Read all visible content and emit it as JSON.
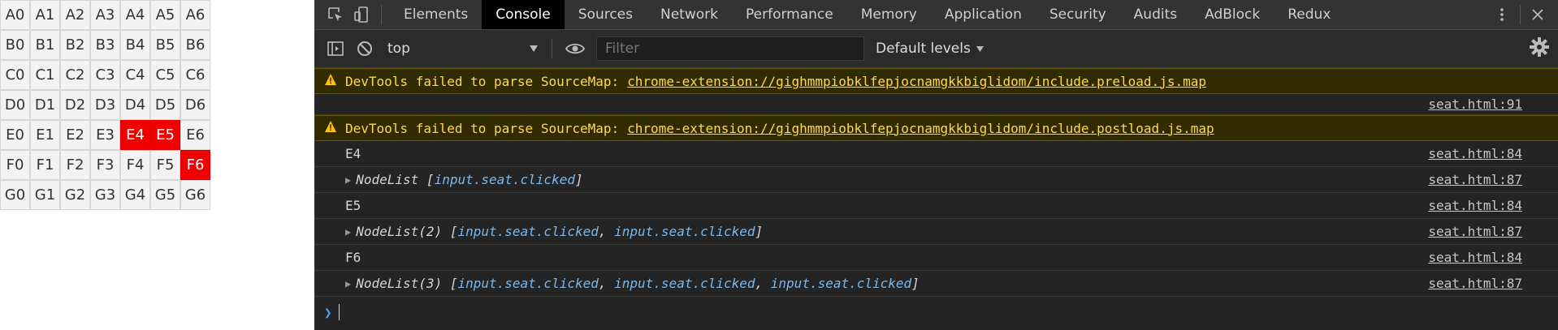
{
  "seats": [
    [
      {
        "label": "A0",
        "clicked": false
      },
      {
        "label": "A1",
        "clicked": false
      },
      {
        "label": "A2",
        "clicked": false
      },
      {
        "label": "A3",
        "clicked": false
      },
      {
        "label": "A4",
        "clicked": false
      },
      {
        "label": "A5",
        "clicked": false
      },
      {
        "label": "A6",
        "clicked": false
      }
    ],
    [
      {
        "label": "B0",
        "clicked": false
      },
      {
        "label": "B1",
        "clicked": false
      },
      {
        "label": "B2",
        "clicked": false
      },
      {
        "label": "B3",
        "clicked": false
      },
      {
        "label": "B4",
        "clicked": false
      },
      {
        "label": "B5",
        "clicked": false
      },
      {
        "label": "B6",
        "clicked": false
      }
    ],
    [
      {
        "label": "C0",
        "clicked": false
      },
      {
        "label": "C1",
        "clicked": false
      },
      {
        "label": "C2",
        "clicked": false
      },
      {
        "label": "C3",
        "clicked": false
      },
      {
        "label": "C4",
        "clicked": false
      },
      {
        "label": "C5",
        "clicked": false
      },
      {
        "label": "C6",
        "clicked": false
      }
    ],
    [
      {
        "label": "D0",
        "clicked": false
      },
      {
        "label": "D1",
        "clicked": false
      },
      {
        "label": "D2",
        "clicked": false
      },
      {
        "label": "D3",
        "clicked": false
      },
      {
        "label": "D4",
        "clicked": false
      },
      {
        "label": "D5",
        "clicked": false
      },
      {
        "label": "D6",
        "clicked": false
      }
    ],
    [
      {
        "label": "E0",
        "clicked": false
      },
      {
        "label": "E1",
        "clicked": false
      },
      {
        "label": "E2",
        "clicked": false
      },
      {
        "label": "E3",
        "clicked": false
      },
      {
        "label": "E4",
        "clicked": true
      },
      {
        "label": "E5",
        "clicked": true
      },
      {
        "label": "E6",
        "clicked": false
      }
    ],
    [
      {
        "label": "F0",
        "clicked": false
      },
      {
        "label": "F1",
        "clicked": false
      },
      {
        "label": "F2",
        "clicked": false
      },
      {
        "label": "F3",
        "clicked": false
      },
      {
        "label": "F4",
        "clicked": false
      },
      {
        "label": "F5",
        "clicked": false
      },
      {
        "label": "F6",
        "clicked": true
      }
    ],
    [
      {
        "label": "G0",
        "clicked": false
      },
      {
        "label": "G1",
        "clicked": false
      },
      {
        "label": "G2",
        "clicked": false
      },
      {
        "label": "G3",
        "clicked": false
      },
      {
        "label": "G4",
        "clicked": false
      },
      {
        "label": "G5",
        "clicked": false
      },
      {
        "label": "G6",
        "clicked": false
      }
    ]
  ],
  "devtools": {
    "tabs": [
      {
        "label": "Elements",
        "active": false
      },
      {
        "label": "Console",
        "active": true
      },
      {
        "label": "Sources",
        "active": false
      },
      {
        "label": "Network",
        "active": false
      },
      {
        "label": "Performance",
        "active": false
      },
      {
        "label": "Memory",
        "active": false
      },
      {
        "label": "Application",
        "active": false
      },
      {
        "label": "Security",
        "active": false
      },
      {
        "label": "Audits",
        "active": false
      },
      {
        "label": "AdBlock",
        "active": false
      },
      {
        "label": "Redux",
        "active": false
      }
    ],
    "toolbar": {
      "context": "top",
      "filter_placeholder": "Filter",
      "levels": "Default levels"
    },
    "console": {
      "warning1": {
        "message": "DevTools failed to parse SourceMap:",
        "link": "chrome-extension://gighmmpiobklfepjocnamgkkbiglidom/include.preload.js.map"
      },
      "warning1_source": "seat.html:91",
      "warning2": {
        "message": "DevTools failed to parse SourceMap:",
        "link": "chrome-extension://gighmmpiobklfepjocnamgkkbiglidom/include.postload.js.map"
      },
      "log1": {
        "text": "E4",
        "source": "seat.html:84"
      },
      "nodelist1": {
        "prefix": "NodeList",
        "items": [
          "input.seat.clicked"
        ],
        "source": "seat.html:87"
      },
      "log2": {
        "text": "E5",
        "source": "seat.html:84"
      },
      "nodelist2": {
        "prefix": "NodeList(2)",
        "items": [
          "input.seat.clicked",
          "input.seat.clicked"
        ],
        "source": "seat.html:87"
      },
      "log3": {
        "text": "F6",
        "source": "seat.html:84"
      },
      "nodelist3": {
        "prefix": "NodeList(3)",
        "items": [
          "input.seat.clicked",
          "input.seat.clicked",
          "input.seat.clicked"
        ],
        "source": "seat.html:87"
      }
    },
    "colors": {
      "accent_link": "#7cb7e8",
      "warning_bg": "#332b00",
      "warning_text": "#ffd94d",
      "seat_clicked": "#f00000"
    },
    "icons": [
      "inspect-element-icon",
      "device-toolbar-icon",
      "more-vertical-icon",
      "close-icon",
      "sidebar-toggle-icon",
      "clear-console-icon",
      "eye-icon",
      "gear-icon",
      "warning-icon"
    ]
  }
}
